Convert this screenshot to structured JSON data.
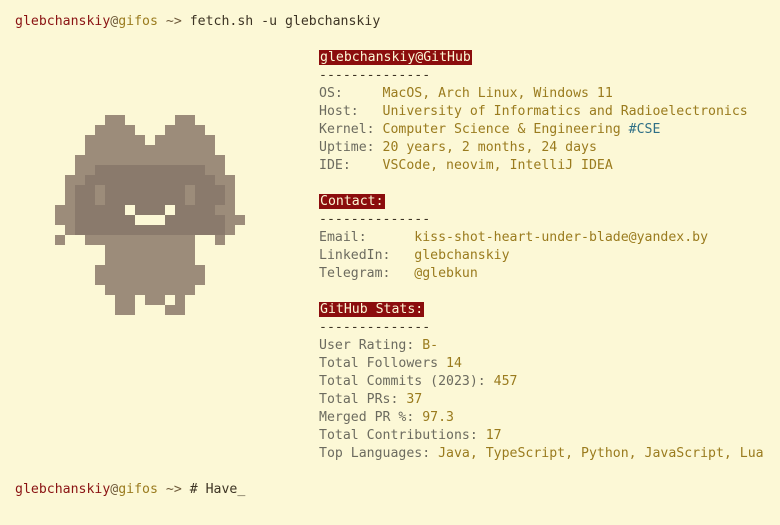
{
  "terminal": {
    "user": "glebchanskiy",
    "at": "@",
    "host": "gifos",
    "prompt": " ~> ",
    "command": "fetch.sh -u glebchanskiy",
    "typed": "# Have_"
  },
  "sections": {
    "github_header": "glebchanskiy@GitHub",
    "divider": "--------------",
    "system": [
      {
        "key": "OS:",
        "pad": "     ",
        "value": "MacOS, Arch Linux, Windows 11"
      },
      {
        "key": "Host:",
        "pad": "   ",
        "value": "University of Informatics and Radioelectronics"
      },
      {
        "key": "Kernel:",
        "pad": " ",
        "value": "Computer Science & Engineering ",
        "tag": "#CSE"
      },
      {
        "key": "Uptime:",
        "pad": " ",
        "value": "20 years, 2 months, 24 days"
      },
      {
        "key": "IDE:",
        "pad": "    ",
        "value": "VSCode, neovim, IntelliJ IDEA"
      }
    ],
    "contact_header": "Contact:",
    "contact": [
      {
        "key": "Email:",
        "pad": "      ",
        "value": "kiss-shot-heart-under-blade@yandex.by"
      },
      {
        "key": "LinkedIn:",
        "pad": "   ",
        "value": "glebchanskiy"
      },
      {
        "key": "Telegram:",
        "pad": "   ",
        "value": "@glebkun"
      }
    ],
    "stats_header": "GitHub Stats:",
    "stats": [
      {
        "key": "User Rating:",
        "pad": " ",
        "value": "B-"
      },
      {
        "key": "Total Followers",
        "pad": " ",
        "value": "14"
      },
      {
        "key": "Total Commits (2023):",
        "pad": " ",
        "value": "457"
      },
      {
        "key": "Total PRs:",
        "pad": " ",
        "value": "37"
      },
      {
        "key": "Merged PR %:",
        "pad": " ",
        "value": "97.3"
      },
      {
        "key": "Total Contributions:",
        "pad": " ",
        "value": "17"
      },
      {
        "key": "Top Languages:",
        "pad": " ",
        "value": "Java, TypeScript, Python, JavaScript, Lua"
      }
    ]
  },
  "colors": {
    "background": "#fcf8d6",
    "user": "#8a1313",
    "host": "#9a7b1e",
    "header_bg": "#8b0d0d",
    "avatar_light": "#9c8c7a",
    "avatar_dark": "#8a7a6c"
  }
}
